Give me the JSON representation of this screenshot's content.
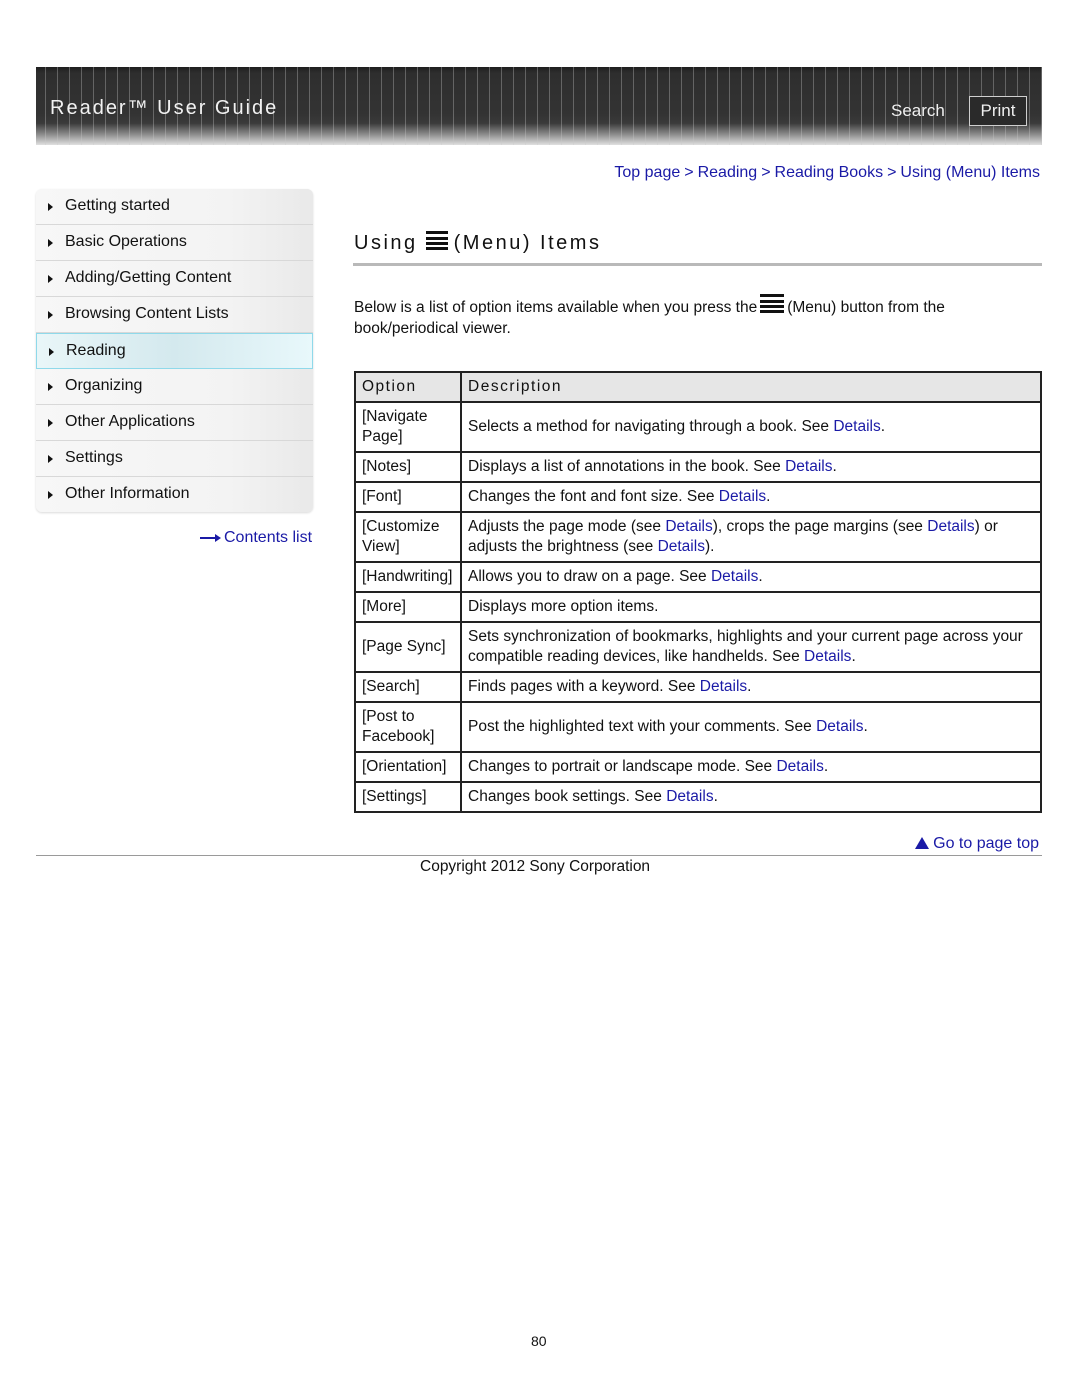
{
  "header": {
    "title": "Reader™ User Guide",
    "search_label": "Search",
    "print_label": "Print"
  },
  "breadcrumb": {
    "items": [
      "Top page",
      "Reading",
      "Reading Books",
      "Using (Menu) Items"
    ],
    "separator": ">"
  },
  "sidebar": {
    "items": [
      {
        "label": "Getting started",
        "active": false
      },
      {
        "label": "Basic Operations",
        "active": false
      },
      {
        "label": "Adding/Getting Content",
        "active": false
      },
      {
        "label": "Browsing Content Lists",
        "active": false
      },
      {
        "label": "Reading",
        "active": true
      },
      {
        "label": "Organizing",
        "active": false
      },
      {
        "label": "Other Applications",
        "active": false
      },
      {
        "label": "Settings",
        "active": false
      },
      {
        "label": "Other Information",
        "active": false
      }
    ],
    "contents_link": "Contents list"
  },
  "main": {
    "title_prefix": "Using",
    "title_icon": "menu-icon",
    "title_suffix": "(Menu) Items",
    "intro_before": "Below is a list of option items available when you press the",
    "intro_after": "(Menu) button from the book/periodical viewer.",
    "table": {
      "headers": [
        "Option",
        "Description"
      ],
      "rows": [
        {
          "option": "[Navigate Page]",
          "desc": [
            {
              "t": "Selects a method for navigating through a book. See "
            },
            {
              "link": "Details"
            },
            {
              "t": "."
            }
          ]
        },
        {
          "option": "[Notes]",
          "desc": [
            {
              "t": "Displays a list of annotations in the book. See "
            },
            {
              "link": "Details"
            },
            {
              "t": "."
            }
          ]
        },
        {
          "option": "[Font]",
          "desc": [
            {
              "t": "Changes the font and font size. See "
            },
            {
              "link": "Details"
            },
            {
              "t": "."
            }
          ]
        },
        {
          "option": "[Customize View]",
          "desc": [
            {
              "t": "Adjusts the page mode (see "
            },
            {
              "link": "Details"
            },
            {
              "t": "), crops the page margins (see "
            },
            {
              "link": "Details"
            },
            {
              "t": ") or adjusts the brightness (see "
            },
            {
              "link": "Details"
            },
            {
              "t": ")."
            }
          ]
        },
        {
          "option": "[Handwriting]",
          "desc": [
            {
              "t": "Allows you to draw on a page. See "
            },
            {
              "link": "Details"
            },
            {
              "t": "."
            }
          ]
        },
        {
          "option": "[More]",
          "desc": [
            {
              "t": "Displays more option items."
            }
          ]
        },
        {
          "option": "[Page Sync]",
          "desc": [
            {
              "t": "Sets synchronization of bookmarks, highlights and your current page across your compatible reading devices, like handhelds. See "
            },
            {
              "link": "Details"
            },
            {
              "t": "."
            }
          ]
        },
        {
          "option": "[Search]",
          "desc": [
            {
              "t": "Finds pages with a keyword. See "
            },
            {
              "link": "Details"
            },
            {
              "t": "."
            }
          ]
        },
        {
          "option": "[Post to Facebook]",
          "desc": [
            {
              "t": "Post the highlighted text with your comments. See "
            },
            {
              "link": "Details"
            },
            {
              "t": "."
            }
          ]
        },
        {
          "option": "[Orientation]",
          "desc": [
            {
              "t": "Changes to portrait or landscape mode. See "
            },
            {
              "link": "Details"
            },
            {
              "t": "."
            }
          ]
        },
        {
          "option": "[Settings]",
          "desc": [
            {
              "t": "Changes book settings. See "
            },
            {
              "link": "Details"
            },
            {
              "t": "."
            }
          ]
        }
      ]
    }
  },
  "footer": {
    "go_to_top": "Go to page top",
    "copyright": "Copyright 2012 Sony Corporation",
    "page_number": "80"
  },
  "colors": {
    "link": "#1a1aa6",
    "header_bg": "#333333",
    "active_item_border": "#8fd9ea"
  }
}
